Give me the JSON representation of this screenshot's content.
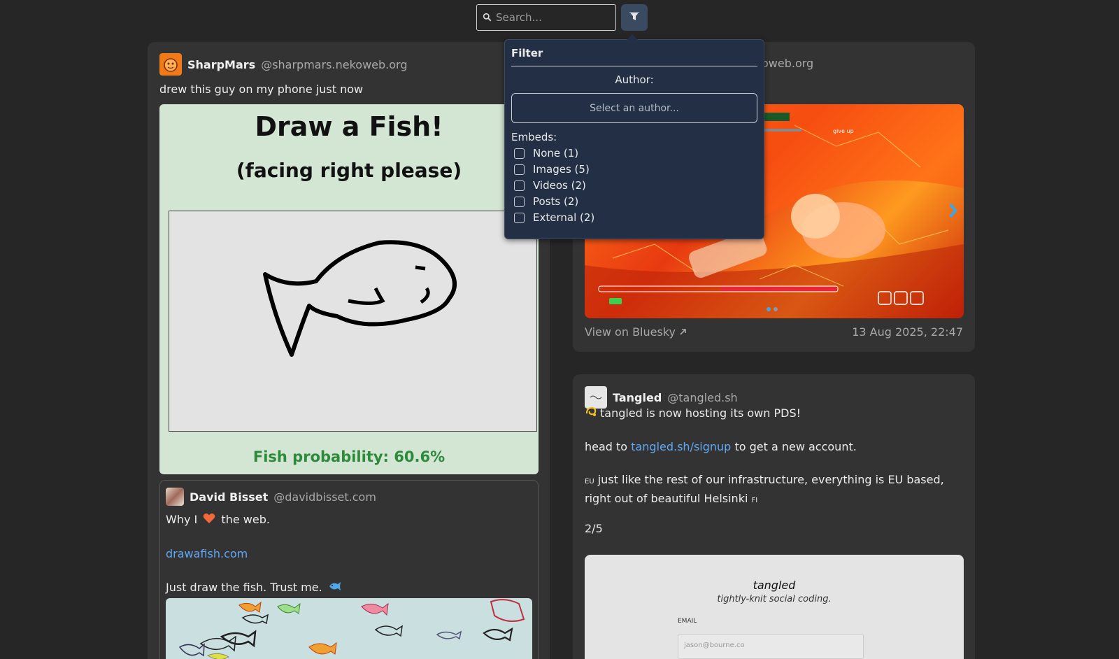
{
  "search": {
    "placeholder": "Search..."
  },
  "filter": {
    "title": "Filter",
    "author_label": "Author:",
    "author_placeholder": "Select an author...",
    "embeds_label": "Embeds:",
    "options": [
      "None (1)",
      "Images (5)",
      "Videos (2)",
      "Posts (2)",
      "External (2)"
    ]
  },
  "post1": {
    "name": "SharpMars",
    "handle": "@sharpmars.nekoweb.org",
    "text": "drew this guy on my phone just now",
    "image": {
      "title": "Draw a Fish!",
      "subtitle": "(facing right please)",
      "probability": "Fish probability: 60.6%"
    },
    "quote": {
      "name": "David Bisset",
      "handle": "@davidbisset.com",
      "line1_a": "Why I",
      "line1_b": "the web.",
      "link": "drawafish.com",
      "line3": "Just draw the fish. Trust me."
    }
  },
  "post2": {
    "handle_partial": "oweb.org",
    "view_link": "View on Bluesky",
    "date": "13 Aug 2025, 22:47",
    "hud_text": "give up"
  },
  "post3": {
    "name": "Tangled",
    "handle": "@tangled.sh",
    "line1": "tangled is now hosting its own PDS!",
    "line2_a": "head to",
    "line2_link": "tangled.sh/signup",
    "line2_b": "to get a new account.",
    "line3_flag1": "EU",
    "line3": "just like the rest of our infrastructure, everything is EU based, right out of beautiful Helsinki",
    "line3_flag2": "FI",
    "counter": "2/5",
    "image": {
      "brand": "tangled",
      "tagline": "tightly-knit social coding.",
      "email_label": "EMAIL",
      "email_placeholder": "jason@bourne.co"
    }
  }
}
